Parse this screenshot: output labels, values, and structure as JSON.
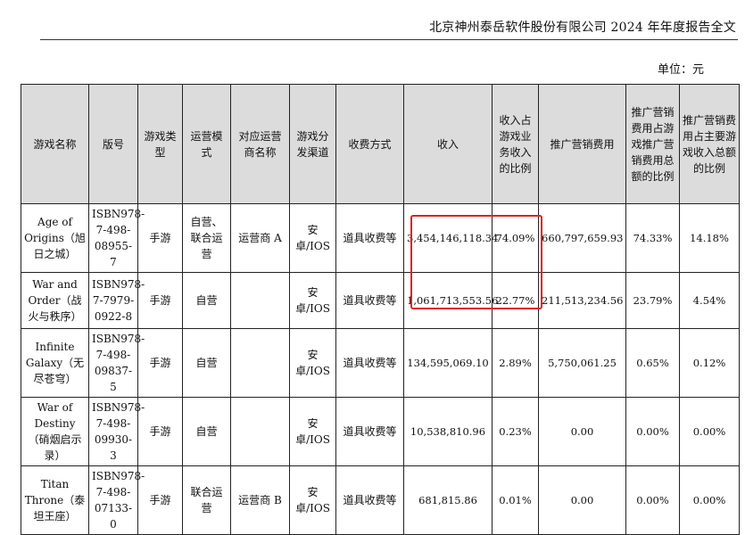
{
  "header": {
    "title": "北京神州泰岳软件股份有限公司 2024 年年度报告全文",
    "unit": "单位：元"
  },
  "table": {
    "columns": [
      "游戏名称",
      "版号",
      "游戏类型",
      "运营模式",
      "对应运营商名称",
      "游戏分发渠道",
      "收费方式",
      "收入",
      "收入占游戏业务收入的比例",
      "推广营销费用",
      "推广营销费用占游戏推广营销费用总额的比例",
      "推广营销费用占主要游戏收入总额的比例"
    ],
    "rows": [
      {
        "name": "Age of Origins（旭日之城）",
        "license": "ISBN978-7-498-08955-7",
        "type": "手游",
        "mode": "自营、联合运营",
        "operator": "运营商 A",
        "channel": "安卓/IOS",
        "charge": "道具收费等",
        "revenue": "3,454,146,118.34",
        "revenue_share": "74.09%",
        "promo": "660,797,659.93",
        "promo_share_total": "74.33%",
        "promo_share_revenue": "14.18%"
      },
      {
        "name": "War and Order（战火与秩序）",
        "license": "ISBN978-7-7979-0922-8",
        "type": "手游",
        "mode": "自营",
        "operator": "",
        "channel": "安卓/IOS",
        "charge": "道具收费等",
        "revenue": "1,061,713,553.56",
        "revenue_share": "22.77%",
        "promo": "211,513,234.56",
        "promo_share_total": "23.79%",
        "promo_share_revenue": "4.54%"
      },
      {
        "name": "Infinite Galaxy（无尽苍穹）",
        "license": "ISBN978-7-498-09837-5",
        "type": "手游",
        "mode": "自营",
        "operator": "",
        "channel": "安卓/IOS",
        "charge": "道具收费等",
        "revenue": "134,595,069.10",
        "revenue_share": "2.89%",
        "promo": "5,750,061.25",
        "promo_share_total": "0.65%",
        "promo_share_revenue": "0.12%"
      },
      {
        "name": "War of Destiny（硝烟启示录）",
        "license": "ISBN978-7-498-09930-3",
        "type": "手游",
        "mode": "自营",
        "operator": "",
        "channel": "安卓/IOS",
        "charge": "道具收费等",
        "revenue": "10,538,810.96",
        "revenue_share": "0.23%",
        "promo": "0.00",
        "promo_share_total": "0.00%",
        "promo_share_revenue": "0.00%"
      },
      {
        "name": "Titan Throne（泰坦王座）",
        "license": "ISBN978-7-498-07133-0",
        "type": "手游",
        "mode": "联合运营",
        "operator": "运营商 B",
        "channel": "安卓/IOS",
        "charge": "道具收费等",
        "revenue": "681,815.86",
        "revenue_share": "0.01%",
        "promo": "0.00",
        "promo_share_total": "0.00%",
        "promo_share_revenue": "0.00%"
      }
    ]
  },
  "colors": {
    "header_bg": "#dcdcdc",
    "highlight": "#e02020",
    "border": "#222222"
  }
}
